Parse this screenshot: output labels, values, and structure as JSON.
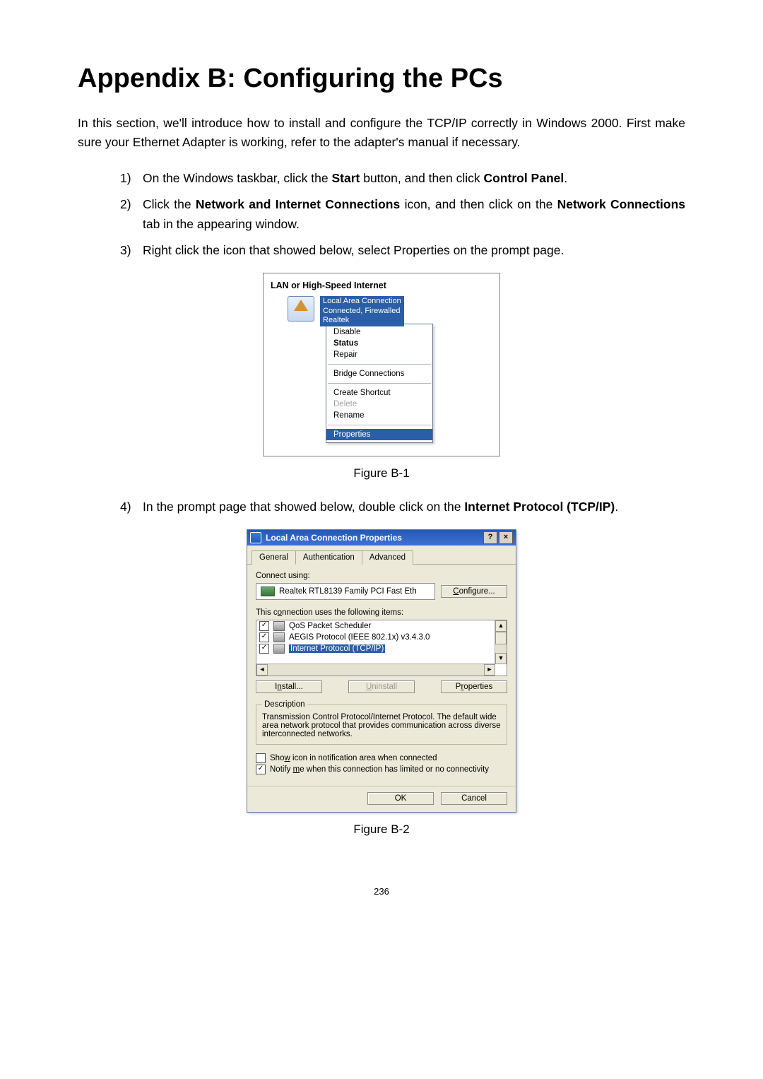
{
  "title": "Appendix B: Configuring the PCs",
  "intro": "In this section, we'll introduce how to install and configure the TCP/IP correctly in Windows 2000. First make sure your Ethernet Adapter is working, refer to the adapter's manual if necessary.",
  "steps": {
    "s1_a": "On the Windows taskbar, click the ",
    "s1_b1": "Start",
    "s1_c": " button, and then click ",
    "s1_b2": "Control Panel",
    "s1_d": ".",
    "s2_a": "Click the ",
    "s2_b1": "Network and Internet Connections",
    "s2_c": " icon, and then click on the ",
    "s2_b2": "Network Connections",
    "s2_d": " tab in the appearing window.",
    "s3": "Right click the icon that showed below, select Properties on the prompt page.",
    "s4_a": "In the prompt page that showed below, double click on the ",
    "s4_b": "Internet Protocol (TCP/IP)",
    "s4_c": "."
  },
  "fig1": {
    "caption": "Figure B-1",
    "header": "LAN or High-Speed Internet",
    "lan_line1": "Local Area Connection",
    "lan_line2": "Connected, Firewalled",
    "lan_line3": "Realtek",
    "menu": {
      "disable": "Disable",
      "status": "Status",
      "repair": "Repair",
      "bridge": "Bridge Connections",
      "shortcut": "Create Shortcut",
      "delete": "Delete",
      "rename": "Rename",
      "properties": "Properties"
    }
  },
  "fig2": {
    "caption": "Figure B-2",
    "titlebar": "Local Area Connection   Properties",
    "help_btn": "?",
    "close_btn": "×",
    "tabs": {
      "general": "General",
      "auth": "Authentication",
      "adv": "Advanced"
    },
    "connect_using": "Connect using:",
    "adapter": "Realtek RTL8139 Family PCI Fast Eth",
    "configure": "Configure...",
    "items_label": "This connection uses the following items:",
    "items": {
      "qos": "QoS Packet Scheduler",
      "aegis": "AEGIS Protocol (IEEE 802.1x) v3.4.3.0",
      "tcpip": "Internet Protocol (TCP/IP)"
    },
    "install": "Install...",
    "uninstall": "Uninstall",
    "properties": "Properties",
    "desc_legend": "Description",
    "desc_text": "Transmission Control Protocol/Internet Protocol. The default wide area network protocol that provides communication across diverse interconnected networks.",
    "show_icon": "Show icon in notification area when connected",
    "notify": "Notify me when this connection has limited or no connectivity",
    "ok": "OK",
    "cancel": "Cancel"
  },
  "page_number": "236"
}
